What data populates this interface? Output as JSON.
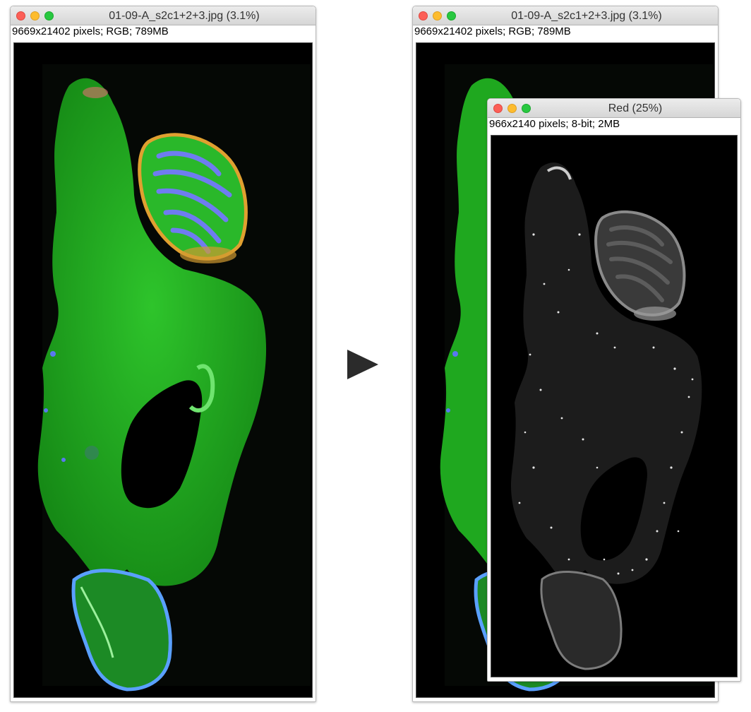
{
  "left_window": {
    "title": "01-09-A_s2c1+2+3.jpg (3.1%)",
    "info": "9669x21402 pixels; RGB; 789MB",
    "image_icon": "fluorescent-brain-section-image"
  },
  "right_window": {
    "title": "01-09-A_s2c1+2+3.jpg (3.1%)",
    "info": "9669x21402 pixels; RGB; 789MB",
    "image_icon": "fluorescent-brain-section-image"
  },
  "red_window": {
    "title": "Red (25%)",
    "info": "966x2140 pixels; 8-bit; 2MB",
    "image_icon": "red-channel-grayscale-image"
  },
  "arrow_icon": "play-arrow-icon",
  "colors": {
    "traffic_close": "#fc5f57",
    "traffic_minimize": "#fdbc2e",
    "traffic_zoom": "#28c840",
    "tissue_green": "#1fb51f",
    "cerebellum_blue": "#5b6ee0"
  }
}
